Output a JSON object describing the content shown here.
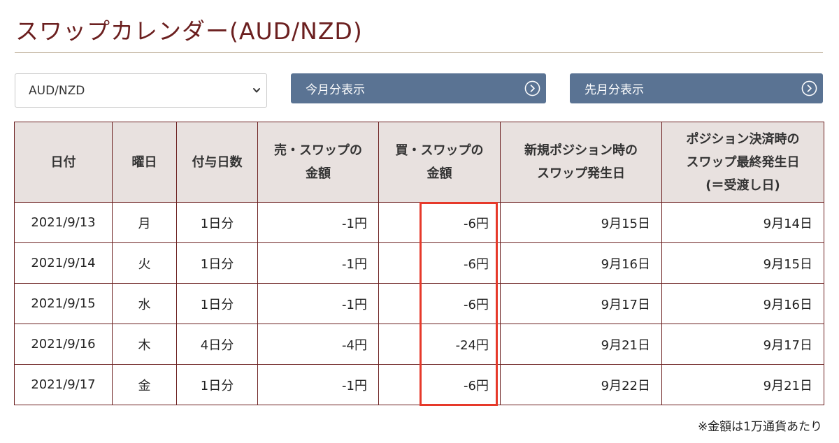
{
  "header": {
    "title": "スワップカレンダー(AUD/NZD)"
  },
  "controls": {
    "pair_select_value": "AUD/NZD",
    "this_month_button": "今月分表示",
    "last_month_button": "先月分表示"
  },
  "table": {
    "headers": {
      "date": "日付",
      "weekday": "曜日",
      "days": "付与日数",
      "sell_1": "売・スワップの",
      "sell_2": "金額",
      "buy_1": "買・スワップの",
      "buy_2": "金額",
      "new_1": "新規ポジション時の",
      "new_2": "スワップ発生日",
      "settle_1": "ポジション決済時の",
      "settle_2": "スワップ最終発生日",
      "settle_3": "(＝受渡し日)"
    },
    "rows": [
      {
        "date": "2021/9/13",
        "weekday": "月",
        "days": "1日分",
        "sell": "-1円",
        "buy": "-6円",
        "new_date": "9月15日",
        "settle_date": "9月14日"
      },
      {
        "date": "2021/9/14",
        "weekday": "火",
        "days": "1日分",
        "sell": "-1円",
        "buy": "-6円",
        "new_date": "9月16日",
        "settle_date": "9月15日"
      },
      {
        "date": "2021/9/15",
        "weekday": "水",
        "days": "1日分",
        "sell": "-1円",
        "buy": "-6円",
        "new_date": "9月17日",
        "settle_date": "9月16日"
      },
      {
        "date": "2021/9/16",
        "weekday": "木",
        "days": "4日分",
        "sell": "-4円",
        "buy": "-24円",
        "new_date": "9月21日",
        "settle_date": "9月17日"
      },
      {
        "date": "2021/9/17",
        "weekday": "金",
        "days": "1日分",
        "sell": "-1円",
        "buy": "-6円",
        "new_date": "9月22日",
        "settle_date": "9月21日"
      }
    ]
  },
  "footnote": "※金額は1万通貨あたり",
  "icons": {
    "select": "chevron-down-icon",
    "buttons": "circle-arrow-right-icon"
  },
  "colors": {
    "title": "#6b1f1f",
    "button": "#5a7393",
    "header_bg": "#e8e1df",
    "highlight": "#e6392a"
  }
}
